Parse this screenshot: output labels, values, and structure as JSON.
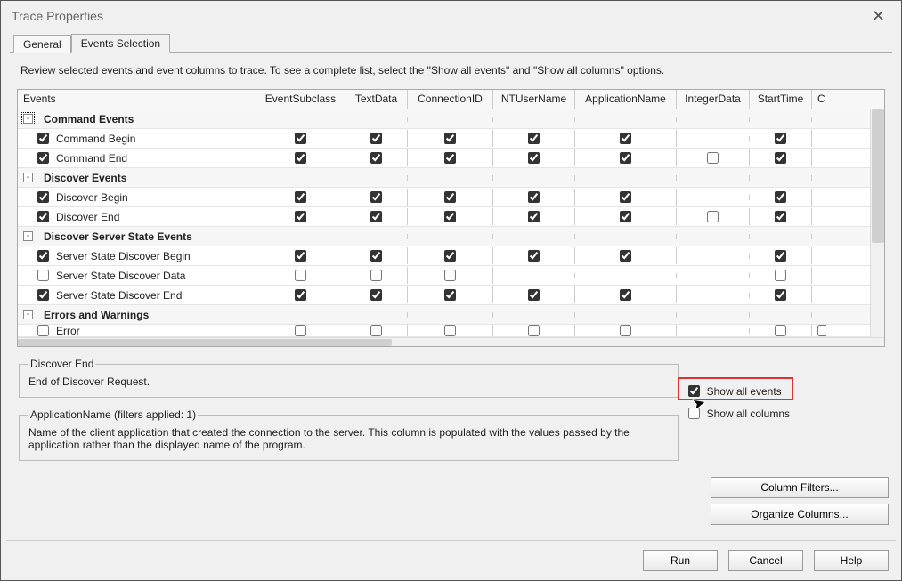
{
  "window": {
    "title": "Trace Properties"
  },
  "tabs": {
    "general": "General",
    "events_selection": "Events Selection",
    "active": "events_selection"
  },
  "instruction": "Review selected events and event columns to trace. To see a complete list, select the \"Show all events\" and \"Show all columns\" options.",
  "columns": {
    "events": "Events",
    "eventsubclass": "EventSubclass",
    "textdata": "TextData",
    "connectionid": "ConnectionID",
    "ntusername": "NTUserName",
    "applicationname": "ApplicationName",
    "integerdata": "IntegerData",
    "starttime": "StartTime",
    "last": "C"
  },
  "groups": [
    {
      "name": "Command Events",
      "expanded": true,
      "focused": true,
      "rows": [
        {
          "label": "Command Begin",
          "checked": true,
          "cells": {
            "eventsubclass": true,
            "textdata": true,
            "connectionid": true,
            "ntusername": true,
            "applicationname": true,
            "integerdata": null,
            "starttime": true,
            "last": null
          }
        },
        {
          "label": "Command End",
          "checked": true,
          "cells": {
            "eventsubclass": true,
            "textdata": true,
            "connectionid": true,
            "ntusername": true,
            "applicationname": true,
            "integerdata": false,
            "starttime": true,
            "last": null
          }
        }
      ]
    },
    {
      "name": "Discover Events",
      "expanded": true,
      "rows": [
        {
          "label": "Discover Begin",
          "checked": true,
          "cells": {
            "eventsubclass": true,
            "textdata": true,
            "connectionid": true,
            "ntusername": true,
            "applicationname": true,
            "integerdata": null,
            "starttime": true,
            "last": null
          }
        },
        {
          "label": "Discover End",
          "checked": true,
          "cells": {
            "eventsubclass": true,
            "textdata": true,
            "connectionid": true,
            "ntusername": true,
            "applicationname": true,
            "integerdata": false,
            "starttime": true,
            "last": null
          }
        }
      ]
    },
    {
      "name": "Discover Server State Events",
      "expanded": true,
      "rows": [
        {
          "label": "Server State Discover Begin",
          "checked": true,
          "cells": {
            "eventsubclass": true,
            "textdata": true,
            "connectionid": true,
            "ntusername": true,
            "applicationname": true,
            "integerdata": null,
            "starttime": true,
            "last": null
          }
        },
        {
          "label": "Server State Discover Data",
          "checked": false,
          "cells": {
            "eventsubclass": false,
            "textdata": false,
            "connectionid": false,
            "ntusername": null,
            "applicationname": null,
            "integerdata": null,
            "starttime": false,
            "last": null
          }
        },
        {
          "label": "Server State Discover End",
          "checked": true,
          "cells": {
            "eventsubclass": true,
            "textdata": true,
            "connectionid": true,
            "ntusername": true,
            "applicationname": true,
            "integerdata": null,
            "starttime": true,
            "last": null
          }
        }
      ]
    },
    {
      "name": "Errors and Warnings",
      "expanded": true,
      "rows": [
        {
          "label": "Error",
          "checked": false,
          "cells": {
            "eventsubclass": false,
            "textdata": false,
            "connectionid": false,
            "ntusername": false,
            "applicationname": false,
            "integerdata": null,
            "starttime": false,
            "last": false
          },
          "partial": true
        }
      ]
    }
  ],
  "description_box": {
    "legend": "Discover End",
    "text": "End of Discover Request."
  },
  "show_options": {
    "show_all_events": {
      "label": "Show all events",
      "checked": true
    },
    "show_all_columns": {
      "label": "Show all columns",
      "checked": false
    }
  },
  "filters_box": {
    "legend": "ApplicationName (filters applied: 1)",
    "text": "Name of the client application that created the connection to the server. This column is populated with the values passed by the application rather than the displayed name of the program."
  },
  "buttons": {
    "column_filters": "Column Filters...",
    "organize_columns": "Organize Columns...",
    "run": "Run",
    "cancel": "Cancel",
    "help": "Help"
  }
}
